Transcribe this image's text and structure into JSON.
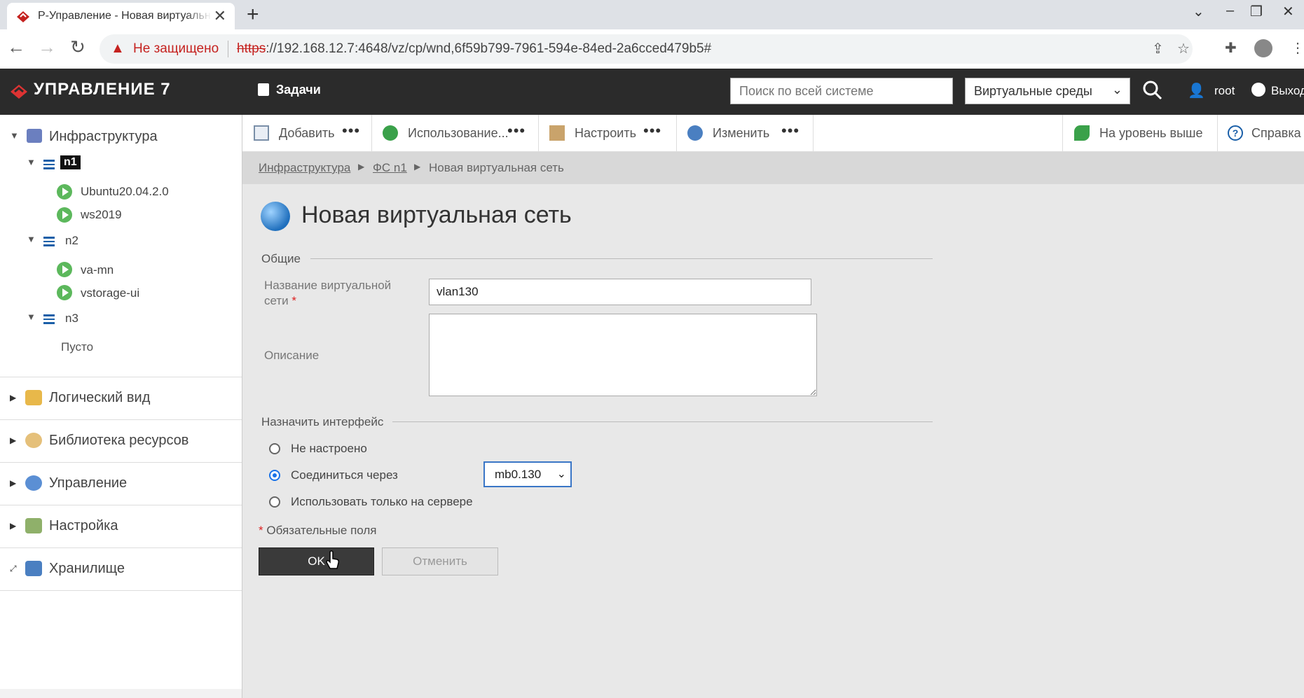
{
  "browser": {
    "tab_title": "Р-Управление - Новая виртуальная сеть",
    "new_tab_label": "+",
    "close_tab_label": "✕",
    "not_secure_label": "Не защищено",
    "url_scheme": "https",
    "url_rest": "://192.168.12.7:4648/vz/cp/wnd,6f59b799-7961-594e-84ed-2a6cced479b5#"
  },
  "header": {
    "brand": "УПРАВЛЕНИЕ 7",
    "tasks_label": "Задачи",
    "search_placeholder": "Поиск по всей системе",
    "scope_value": "Виртуальные среды",
    "user_name": "root",
    "logout_label": "Выход"
  },
  "sidebar": {
    "root_label": "Инфраструктура",
    "nodes": [
      {
        "label": "n1",
        "vms": [
          "Ubuntu20.04.2.0",
          "ws2019"
        ]
      },
      {
        "label": "n2",
        "vms": [
          "va-mn",
          "vstorage-ui"
        ]
      },
      {
        "label": "n3",
        "empty_label": "Пусто"
      }
    ],
    "sections": [
      "Логический вид",
      "Библиотека ресурсов",
      "Управление",
      "Настройка",
      "Хранилище"
    ]
  },
  "toolbar": {
    "add_label": "Добавить",
    "usage_label": "Использование...",
    "configure_label": "Настроить",
    "change_label": "Изменить",
    "level_up_label": "На уровень выше",
    "help_label": "Справка",
    "more_label": "•••"
  },
  "breadcrumb": {
    "items": [
      "Инфраструктура",
      "ФС n1",
      "Новая виртуальная сеть"
    ]
  },
  "form": {
    "title": "Новая виртуальная сеть",
    "general_group": "Общие",
    "name_label_line1": "Название виртуальной",
    "name_label_line2": "сети",
    "required_mark": "*",
    "name_value": "vlan130",
    "description_label": "Описание",
    "description_value": "",
    "interface_group": "Назначить интерфейс",
    "radio_options": [
      "Не настроено",
      "Соединиться через",
      "Использовать только на сервере"
    ],
    "selected_option": "Соединиться через",
    "interface_value": "mb0.130",
    "required_note": "Обязательные поля",
    "ok_label": "OK",
    "cancel_label": "Отменить"
  },
  "colors": {
    "header_bg": "#2b2b2b",
    "accent": "#1a73e8",
    "vm_running": "#5cb85c",
    "danger": "#c5221f"
  }
}
